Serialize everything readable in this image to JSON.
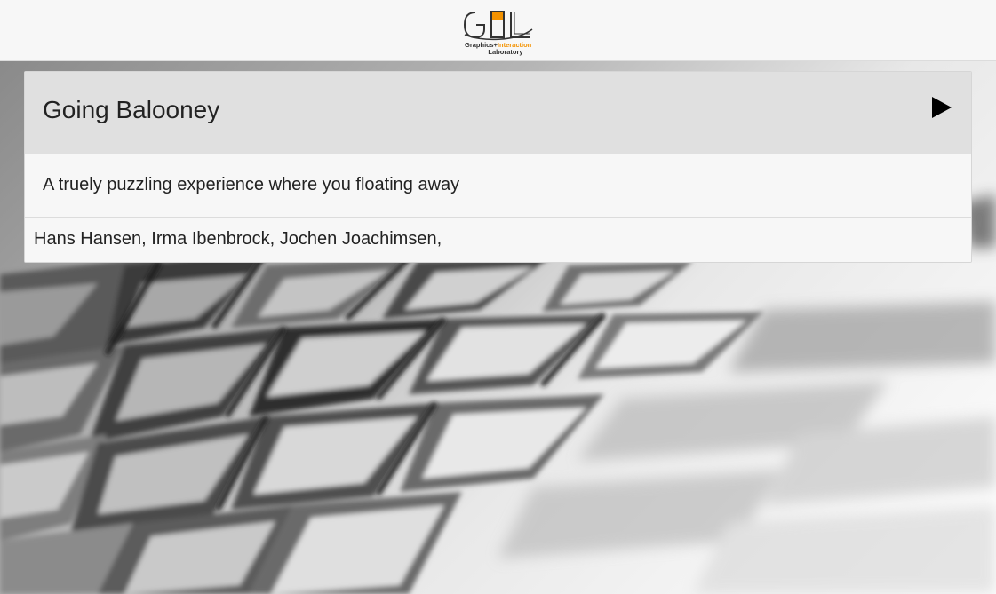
{
  "header": {
    "logo": {
      "icon": "gil-logo-icon",
      "text_line1": "Graphics+Interaction",
      "text_line2": "Laboratory",
      "accent_color": "#f39200"
    }
  },
  "card": {
    "title": "Going Balooney",
    "description": "A truely puzzling experience where you floating away",
    "authors": "Hans Hansen, Irma Ibenbrock, Jochen Joachimsen,",
    "play_icon": "play-icon"
  }
}
